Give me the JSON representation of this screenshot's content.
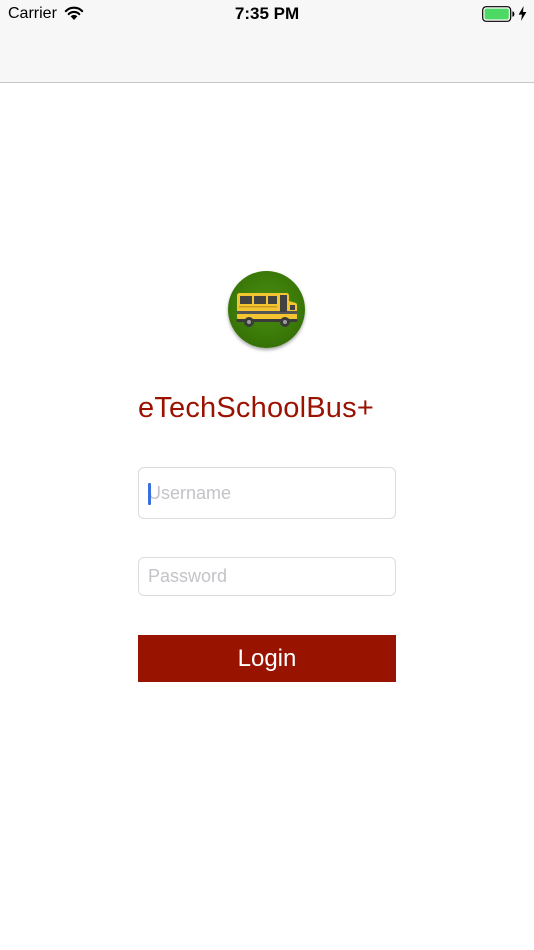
{
  "status_bar": {
    "carrier": "Carrier",
    "time": "7:35 PM",
    "icons": [
      "wifi-icon",
      "battery-icon",
      "charging-icon"
    ]
  },
  "logo": {
    "icon": "school-bus-icon"
  },
  "app": {
    "title": "eTechSchoolBus+"
  },
  "form": {
    "username_placeholder": "Username",
    "username_value": "",
    "password_placeholder": "Password",
    "password_value": "",
    "login_label": "Login"
  },
  "colors": {
    "brand_red": "#981400",
    "title_red": "#9a1200",
    "logo_green": "#3b7a08",
    "battery_green": "#4cd964",
    "bar_background": "#f7f7f7"
  }
}
